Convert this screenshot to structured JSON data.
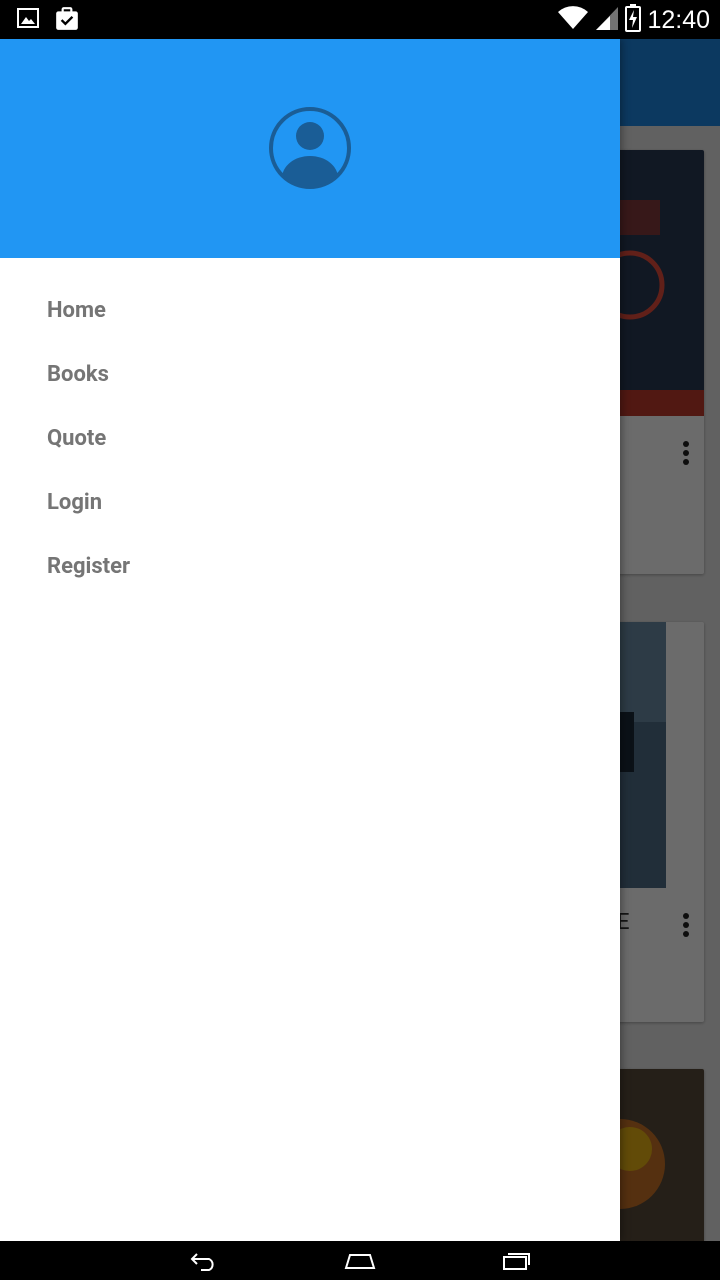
{
  "status_bar": {
    "time": "12:40",
    "icons": [
      "image-notification-icon",
      "clipboard-check-icon",
      "wifi-icon",
      "cell-signal-icon",
      "battery-charging-icon"
    ]
  },
  "drawer": {
    "header_color": "#2196f3",
    "avatar_icon": "account-circle-icon",
    "menu": [
      {
        "label": "Home"
      },
      {
        "label": "Books"
      },
      {
        "label": "Quote"
      },
      {
        "label": "Login"
      },
      {
        "label": "Register"
      }
    ]
  },
  "background": {
    "appbar_color": "#1e88e5",
    "card_title_fragment": "E",
    "card_icons": [
      "more-vert-icon"
    ]
  },
  "nav_bar": {
    "icons": [
      "back-icon",
      "home-icon",
      "recents-icon"
    ]
  }
}
